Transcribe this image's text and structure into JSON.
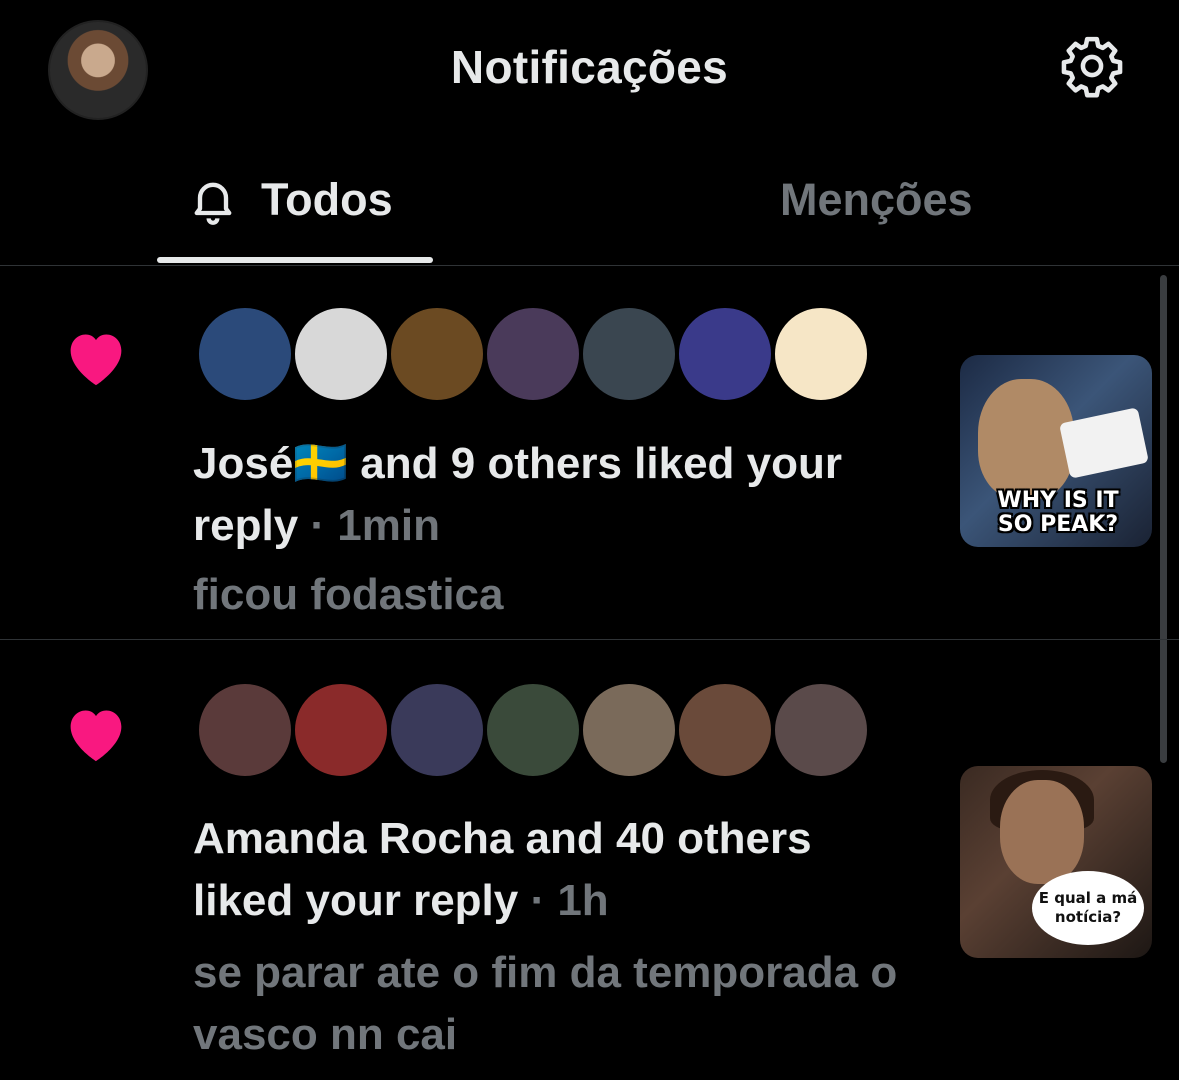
{
  "header": {
    "title": "Notificações"
  },
  "tabs": {
    "all_label": "Todos",
    "mentions_label": "Menções",
    "selected": "Todos"
  },
  "notifications": [
    {
      "type": "like",
      "actor": "José🇸🇪",
      "text_main": " and 9 others liked your reply",
      "time": " · 1min",
      "snippet": "ficou fodastica",
      "thumbnail_caption": "WHY IS IT SO PEAK?",
      "avatar_colors": [
        "#2b4a7a",
        "#d8d8d8",
        "#6b4a22",
        "#4a3a5a",
        "#3a4650",
        "#3a3a8a",
        "#f6e6c6"
      ]
    },
    {
      "type": "like",
      "actor": "Amanda Rocha",
      "text_main": " and 40 others liked your reply",
      "time": " · 1h",
      "snippet": "se parar ate o fim da temporada o vasco nn cai",
      "thumbnail_caption": "E qual a má notícia?",
      "avatar_colors": [
        "#5a3a3a",
        "#8a2a2a",
        "#3a3a5a",
        "#3a4a3a",
        "#7a6a5a",
        "#6a4a3a",
        "#5a4a4a"
      ]
    }
  ],
  "colors": {
    "heart": "#f91880",
    "secondary_text": "#71767b",
    "primary_text": "#e7e9ea",
    "divider": "#2f3336"
  },
  "icons": [
    "settings-gear-icon",
    "bell-icon",
    "heart-icon"
  ]
}
